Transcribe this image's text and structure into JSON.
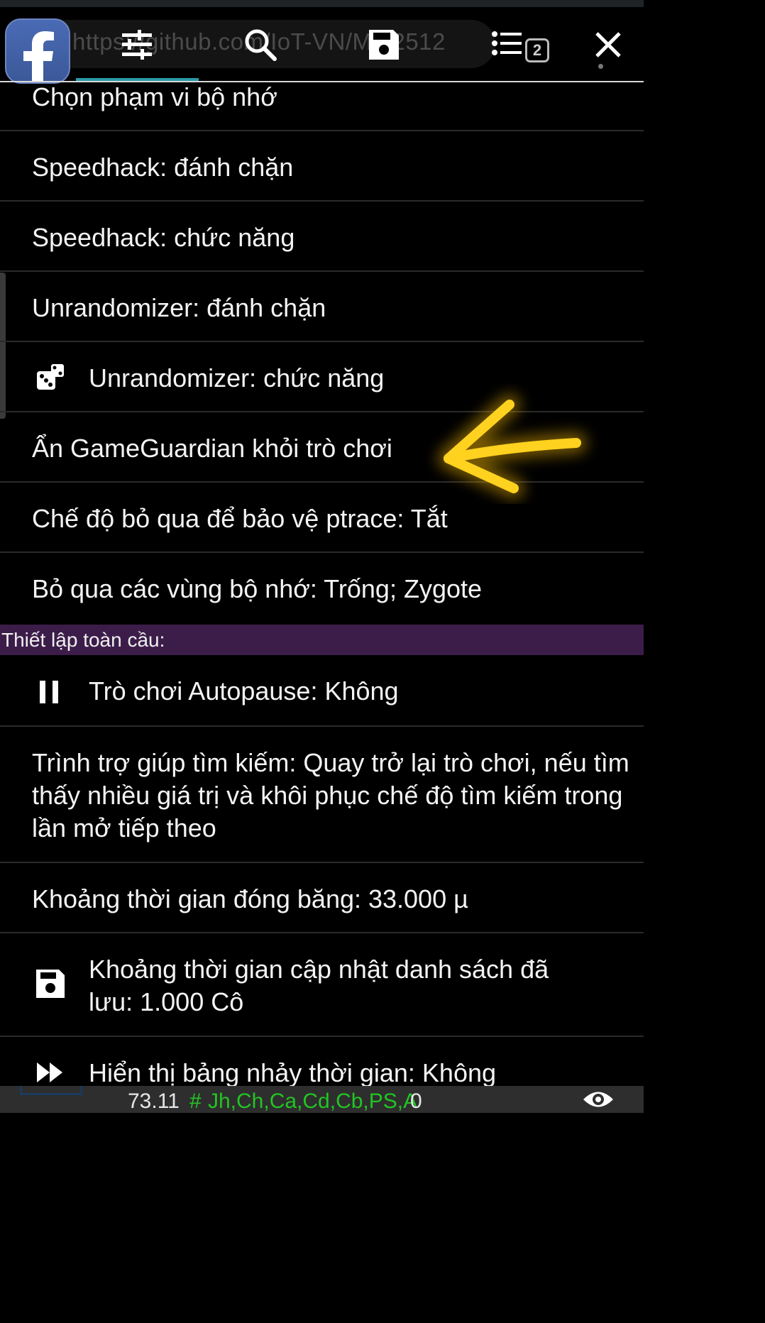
{
  "toolbar": {
    "url": "https://github.com/IoT-VN/MM2512",
    "tab_count": "2",
    "icons": [
      "settings-sliders-icon",
      "search-icon",
      "save-icon",
      "list-icon",
      "close-icon"
    ]
  },
  "app_logo": "facebook-logo",
  "settings": {
    "items": [
      {
        "label": "Chọn phạm vi bộ nhớ"
      },
      {
        "label": "Speedhack: đánh chặn"
      },
      {
        "label": "Speedhack: chức năng"
      },
      {
        "label": "Unrandomizer: đánh chặn"
      },
      {
        "label": "Unrandomizer: chức năng",
        "icon": "dice-icon"
      },
      {
        "label": "Ẩn GameGuardian khỏi trò chơi"
      },
      {
        "label": "Chế độ bỏ qua để bảo vệ ptrace: Tắt"
      },
      {
        "label": "Bỏ qua các vùng bộ nhớ: Trống; Zygote"
      }
    ],
    "section_title": "Thiết lập toàn cầu:",
    "global_items": [
      {
        "label": "Trò chơi Autopause: Không",
        "icon": "pause-icon"
      },
      {
        "label": "Trình trợ giúp tìm kiếm: Quay trở lại trò chơi, nếu tìm thấy nhiều giá trị và khôi phục chế độ tìm kiếm trong lần mở tiếp theo"
      },
      {
        "label": "Khoảng thời gian đóng băng: 33.000 µ"
      },
      {
        "label": "Khoảng thời gian cập nhật danh sách đã lưu: 1.000 Cô",
        "icon": "save-icon"
      },
      {
        "label": "Hiển thị bảng nhảy thời gian: Không",
        "icon": "fast-forward-icon"
      }
    ]
  },
  "status_bar": {
    "value": "73.11",
    "hash": "#",
    "regions": "Jh,Ch,Ca,Cd,Cb,PS,A",
    "count": "0"
  },
  "colors": {
    "background": "#000000",
    "section_header": "#3c1d4a",
    "accent_underline": "#2b99a8",
    "status_green": "#23c423",
    "annotation_arrow": "#f5c518"
  }
}
